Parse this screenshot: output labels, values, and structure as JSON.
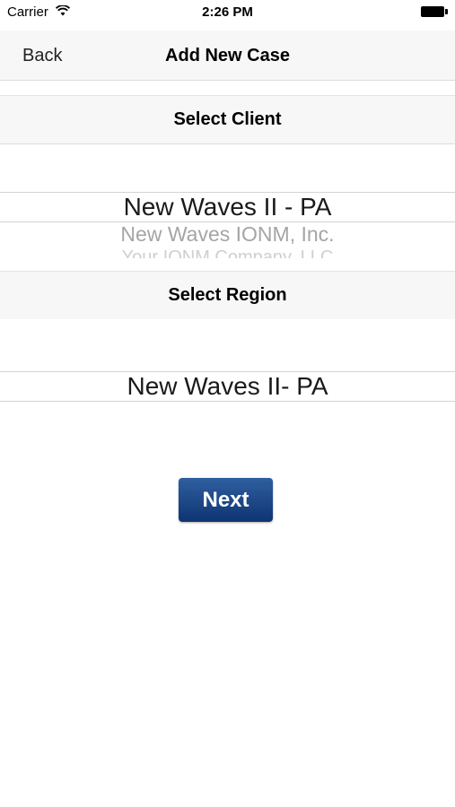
{
  "status_bar": {
    "carrier": "Carrier",
    "time": "2:26 PM"
  },
  "nav": {
    "back_label": "Back",
    "title": "Add New Case"
  },
  "client_section": {
    "header": "Select Client",
    "selected": "New Waves II - PA",
    "next_option": "New Waves IONM, Inc.",
    "faded_option": "Your IONM Company, LLC"
  },
  "region_section": {
    "header": "Select Region",
    "selected": "New Waves II- PA"
  },
  "next_button": {
    "label": "Next"
  },
  "colors": {
    "button_top": "#2f5fa0",
    "button_bottom": "#0e3471",
    "bar_bg": "#f7f7f7"
  }
}
